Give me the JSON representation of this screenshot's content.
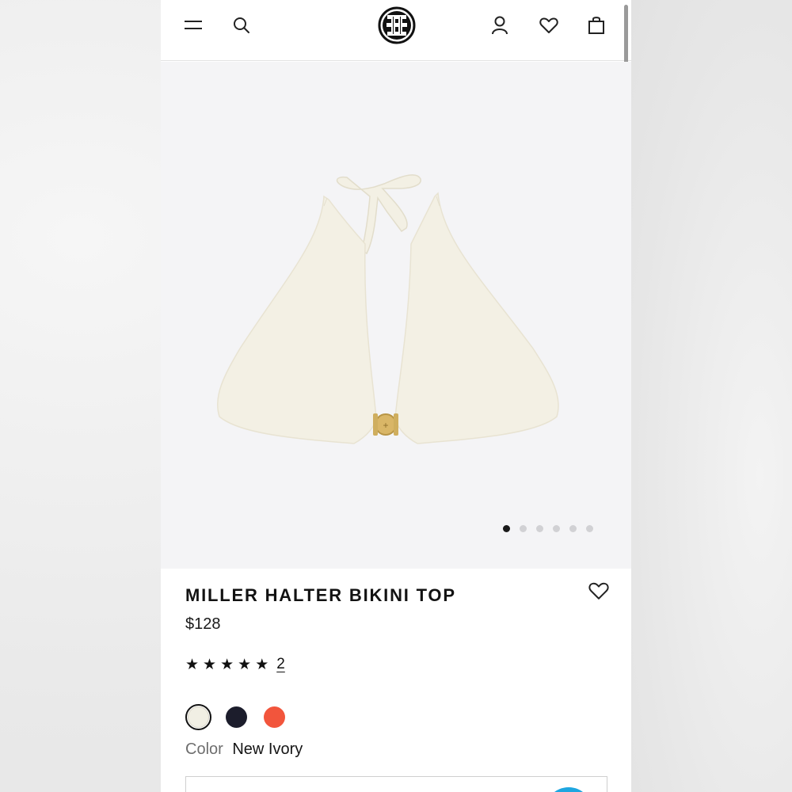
{
  "header": {
    "menu_icon": "hamburger-menu-icon",
    "search_icon": "search-icon",
    "logo": "brand-logo",
    "account_icon": "account-icon",
    "wishlist_icon": "heart-icon",
    "bag_icon": "shopping-bag-icon"
  },
  "gallery": {
    "image_count": 6,
    "active_index": 0
  },
  "product": {
    "title": "MILLER HALTER BIKINI TOP",
    "price": "$128",
    "rating": 5,
    "rating_max": 5,
    "review_count": "2",
    "color_label": "Color",
    "color_value": "New Ivory",
    "swatches": [
      {
        "color": "#f1efe4",
        "selected": true
      },
      {
        "color": "#1c1d2c",
        "selected": false
      },
      {
        "color": "#f2553c",
        "selected": false
      }
    ]
  },
  "colors": {
    "gallery_bg": "#f4f4f6",
    "text_primary": "#121212",
    "dot_inactive": "#d1d1d4",
    "dot_active": "#1a1a1a",
    "chat_accent": "#1ea6e0"
  }
}
